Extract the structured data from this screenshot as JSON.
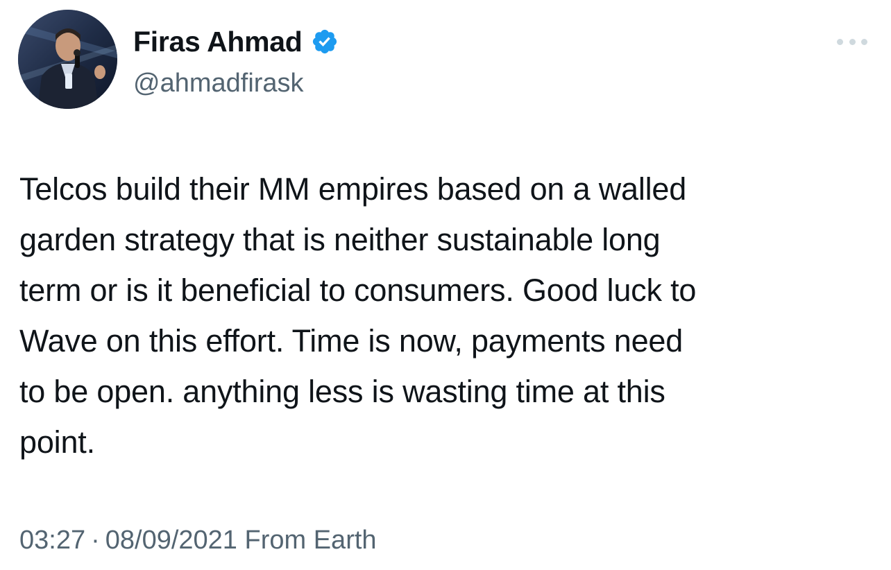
{
  "author": {
    "display_name": "Firas Ahmad",
    "handle": "@ahmadfirask",
    "verified": true,
    "verified_color": "#1d9bf0"
  },
  "icons": {
    "avatar": "profile-photo",
    "verified": "verified-badge-icon",
    "more": "more-options-icon"
  },
  "tweet": {
    "text": "Telcos build their MM empires based on a walled\ngarden strategy that is neither sustainable long\nterm or is it beneficial to consumers. Good luck to\nWave on this effort. Time is now, payments need\nto be open. anything less is wasting time at this\npoint."
  },
  "meta": {
    "time": "03:27",
    "separator": "·",
    "date": "08/09/2021",
    "source": "From Earth"
  },
  "colors": {
    "text_primary": "#0f1419",
    "text_secondary": "#536471"
  }
}
